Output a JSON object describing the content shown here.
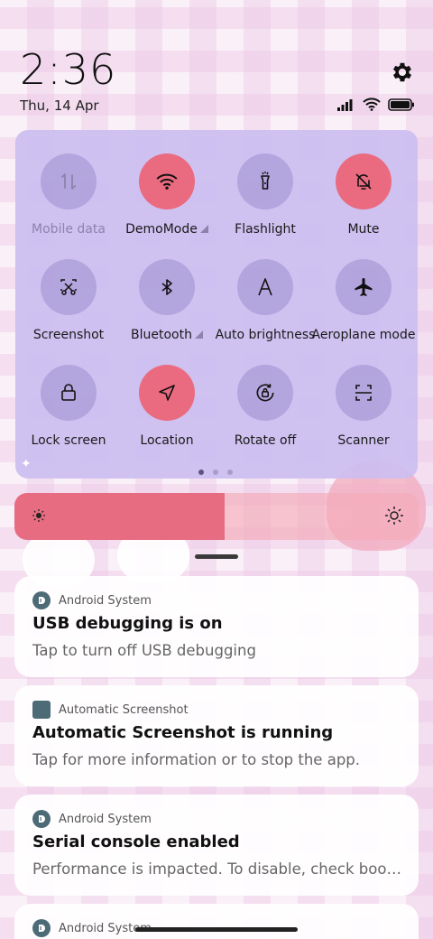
{
  "status_bar": {
    "time": "2:36",
    "date": "Thu, 14 Apr",
    "icons": [
      "signal-icon",
      "wifi-icon",
      "battery-icon"
    ]
  },
  "quick_settings": {
    "tiles": [
      {
        "label": "Mobile data",
        "icon": "mobile-data-icon",
        "state": "unavailable"
      },
      {
        "label": "DemoMode",
        "icon": "wifi-icon",
        "state": "on",
        "expandable": true
      },
      {
        "label": "Flashlight",
        "icon": "flashlight-icon",
        "state": "off"
      },
      {
        "label": "Mute",
        "icon": "bell-off-icon",
        "state": "on"
      },
      {
        "label": "Screenshot",
        "icon": "screenshot-icon",
        "state": "off"
      },
      {
        "label": "Bluetooth",
        "icon": "bluetooth-icon",
        "state": "off",
        "expandable": true
      },
      {
        "label": "Auto brightness",
        "icon": "auto-brightness-icon",
        "state": "off"
      },
      {
        "label": "Aeroplane mode",
        "icon": "airplane-icon",
        "state": "off"
      },
      {
        "label": "Lock screen",
        "icon": "lock-icon",
        "state": "off"
      },
      {
        "label": "Location",
        "icon": "location-icon",
        "state": "on"
      },
      {
        "label": "Rotate off",
        "icon": "rotate-lock-icon",
        "state": "off"
      },
      {
        "label": "Scanner",
        "icon": "scanner-icon",
        "state": "off"
      }
    ],
    "page_count": 3,
    "current_page": 1
  },
  "brightness": {
    "level": 0.52
  },
  "notifications": [
    {
      "app": "Android System",
      "title": "USB debugging is on",
      "text": "Tap to turn off USB debugging"
    },
    {
      "app": "Automatic Screenshot",
      "title": "Automatic Screenshot is running",
      "text": "Tap for more information or to stop the app."
    },
    {
      "app": "Android System",
      "title": "Serial console enabled",
      "text": "Performance is impacted. To disable, check bootl…"
    },
    {
      "app": "Android System",
      "title": "",
      "text": ""
    }
  ],
  "colors": {
    "active_tile": "#ea6b80",
    "panel": "#cbbef0",
    "brightness_fill": "#e76c81"
  }
}
